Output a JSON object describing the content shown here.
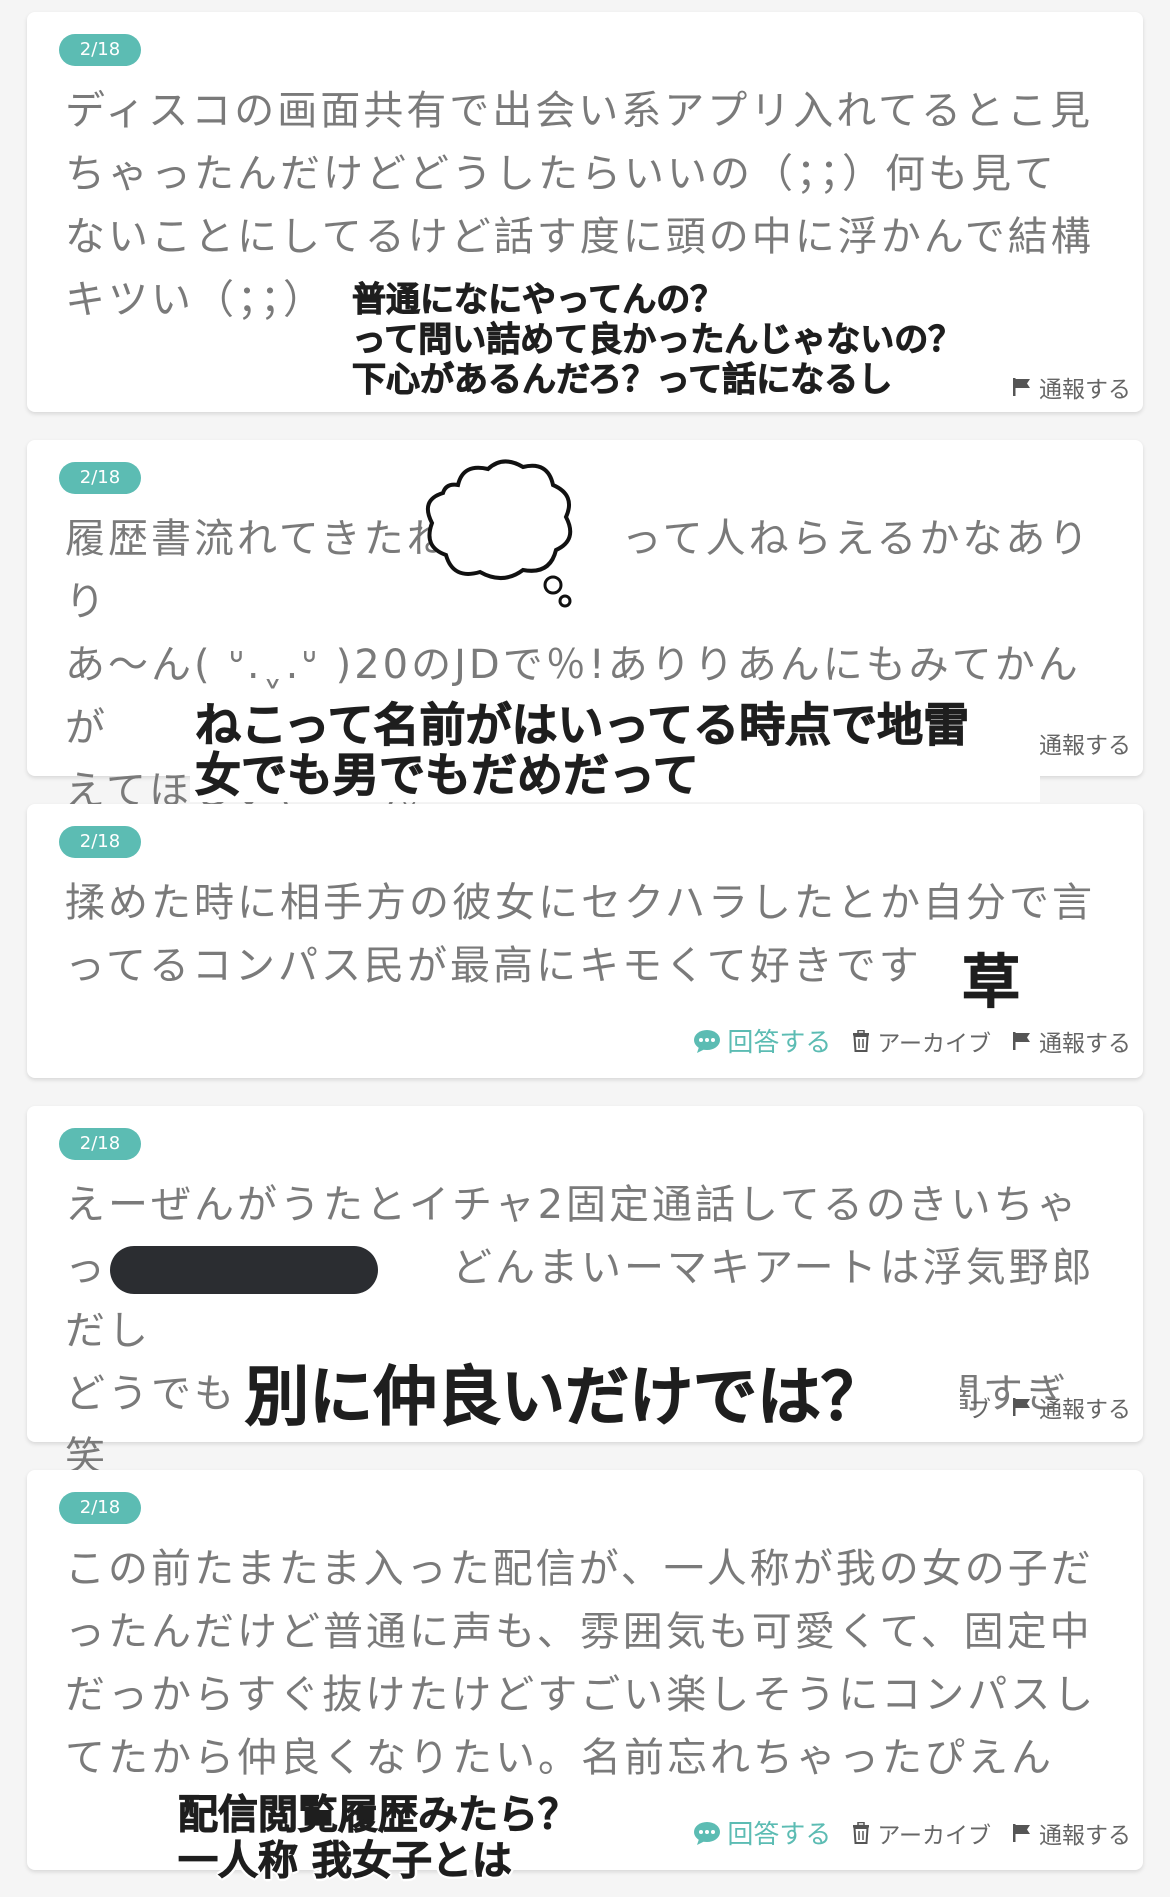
{
  "posts": [
    {
      "date": "2/18",
      "text": "ディスコの画面共有で出会い系アプリ入れてるとこ見\nちゃったんだけどどうしたらいいの（；；）何も見て\nないことにしてるけど話す度に頭の中に浮かんで結構\nキツい（；；）",
      "actions": {
        "report": "通報する"
      },
      "comment": "普通になにやってんの？\nって問い詰めて良かったんじゃないの？\n下心があるんだろ？って話になるし"
    },
    {
      "date": "2/18",
      "text": "履歴書流れてきたね　　　　って人ねらえるかなありり\nあ〜ん( ᐡ.ˬ.ᐡ )20のJDで％!ありりあんにもみてかんが\nえてほしい(ᵕ̈ ̯ ᵕ̈ )。",
      "actions": {
        "report": "通報する"
      },
      "comment": "ねこって名前がはいってる時点で地雷\n女でも男でもだめだって"
    },
    {
      "date": "2/18",
      "text": "揉めた時に相手方の彼女にセクハラしたとか自分で言\nってるコンパス民が最高にキモくて好きです",
      "actions": {
        "reply": "回答する",
        "archive": "アーカイブ",
        "report": "通報する"
      },
      "comment": "草"
    },
    {
      "date": "2/18",
      "text": "えーぜんがうたとイチャ2固定通話してるのきいちゃ\nっ　　　　　　　　どんまいーマキアートは浮気野郎だし\nどうでもいいか笑、証拠もあります この界隈闇すぎ笑",
      "actions": {
        "archive_tail": "ブ",
        "report": "通報する"
      },
      "comment": "別に仲良いだけでは？"
    },
    {
      "date": "2/18",
      "text": "この前たまたま入った配信が、一人称が我の女の子だ\nったんだけど普通に声も、雰囲気も可愛くて、固定中\nだっからすぐ抜けたけどすごい楽しそうにコンパスし\nてたから仲良くなりたい。名前忘れちゃったぴえん",
      "actions": {
        "reply": "回答する",
        "archive": "アーカイブ",
        "report": "通報する"
      },
      "comment": "配信閲覧履歴みたら？\n一人称 我女子とは"
    }
  ],
  "colors": {
    "accent": "#5cbcb3",
    "body_text": "#7a7a7a",
    "overlay_text": "#1e1e1e",
    "redaction": "#2b2d31"
  },
  "icons": [
    "chat-bubble-icon",
    "trash-icon",
    "flag-icon",
    "thought-bubble-sticker"
  ]
}
